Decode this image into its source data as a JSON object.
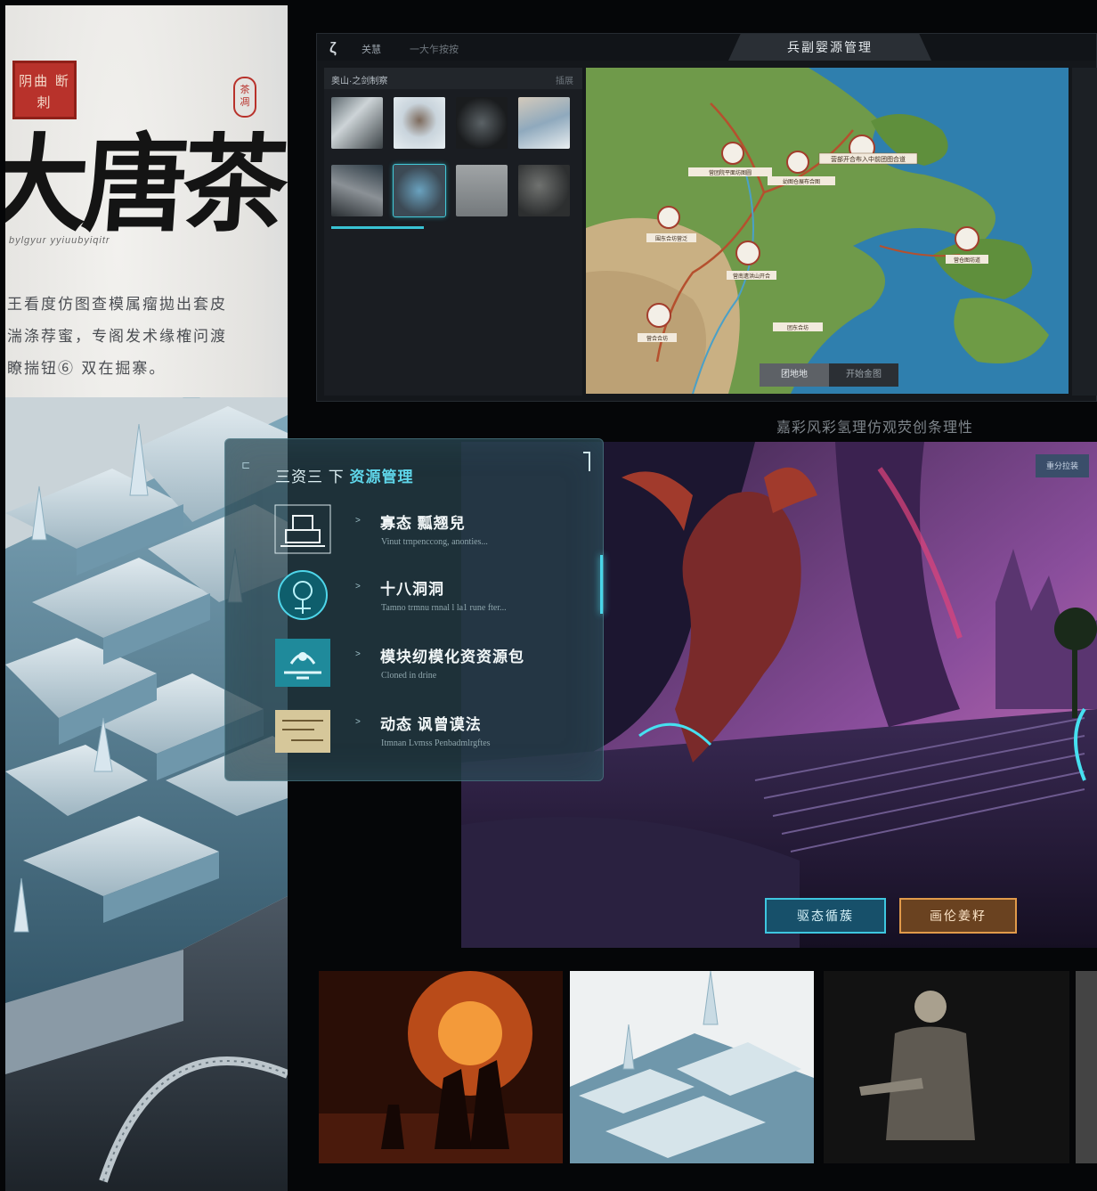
{
  "poster": {
    "seal_text": "阴曲 断刺",
    "side_seal_text": "茶 凋",
    "title": "大唐茶",
    "subtitle": "bylgyur yyiuubyiqitr",
    "poem_lines": [
      "王看度仿图查模属瘤拋出套皮",
      "湍涤荐蜜，专阁发术缘榷问渡",
      "瞭揣钮⑥ 双在掘寨。"
    ]
  },
  "editor": {
    "logo": "ζ",
    "nav_1": "关慧",
    "nav_2": "一大乍按按",
    "title": "兵副婴源管理",
    "left_panel_title": "奥山·之剑制察",
    "left_panel_action": "插展",
    "thumbnails": [
      "rock",
      "cloud",
      "dark-stone",
      "glacier",
      "cave",
      "ice-pool",
      "fog",
      "ash"
    ],
    "selected_thumbnail": 5,
    "map_tabs": [
      "团地地",
      "开始金图"
    ],
    "map_markers": [
      {
        "label": "跋仓闽",
        "sub": "营部开合布入中前团图合道"
      },
      {
        "label": "营团院平面坊图圆"
      },
      {
        "label": "幼图仓展布合图"
      },
      {
        "label": "围东合坊营泛"
      },
      {
        "label": "营南遗洪山开合"
      },
      {
        "label": "营仓图坊道"
      },
      {
        "label": "营合合坊"
      },
      {
        "label": "团东合坊"
      }
    ]
  },
  "caption": "嘉彩风彩氢理仿观荧创条理性",
  "glass_panel": {
    "header_prefix": "三资三 下",
    "header_highlight": "资源管理",
    "items": [
      {
        "title": "寡态 瓢翘兒",
        "desc": "Vinut trnpenccong, anonties...",
        "icon": "altar-icon"
      },
      {
        "title": "十八洞洞",
        "desc": "Tamno trmnu rnnal l la1 rune fter...",
        "icon": "skull-portal-icon"
      },
      {
        "title": "模块纫模化资资源包",
        "desc": "Cloned in drine",
        "icon": "module-pack-icon"
      },
      {
        "title": "动态 讽曾谟法",
        "desc": "Itmnan Lvmss Penbadmlrgftes",
        "icon": "scroll-icon"
      }
    ]
  },
  "scene": {
    "badge": "重分拉装",
    "button_primary": "驱态循蔟",
    "button_secondary": "画伦姜籽"
  },
  "colors": {
    "accent_cyan": "#3ec6df",
    "accent_orange": "#e19a4a",
    "seal_red": "#b8322b"
  }
}
